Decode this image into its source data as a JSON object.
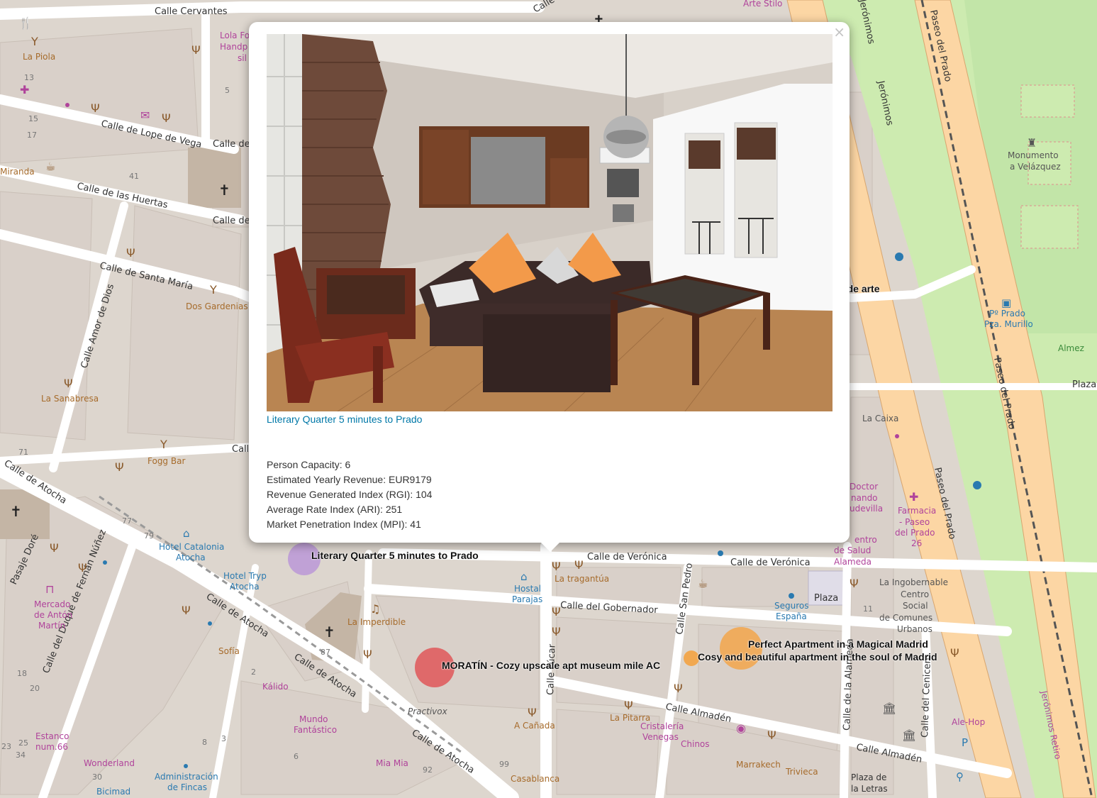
{
  "map": {
    "streets": [
      "Calle Cervantes",
      "Calle de Lope de Vega",
      "Calle de las Huertas",
      "Calle de Santa María",
      "Calle Amor de Dios",
      "Calle de Atocha",
      "Calle del Duque de Fernán Núñez",
      "Pasaje Doré",
      "Calle de Verónica",
      "Calle del Gobernador",
      "Calle San Pedro",
      "Calle Almadén",
      "Calle de la Alameda",
      "Calle del Cenicero",
      "Paseo del Prado",
      "Jerónimos",
      "Calle Fúcar",
      "Calle de",
      "Call",
      "Calle"
    ],
    "places": [
      "La Piola",
      "Lola Fo",
      "Handp",
      "sil",
      "Dos Gardenias",
      "La Sanabresa",
      "Fogg Bar",
      "Hotel Catalonia",
      "Atocha",
      "Hotel Tryp",
      "Mercado",
      "de Antón",
      "Martín",
      "Sofía",
      "Kálido",
      "Mundo",
      "Fantástico",
      "Wonderland",
      "Administración",
      "de Fincas",
      "Bicimad",
      "Estanco",
      "num.66",
      "La Imperdible",
      "Hostal",
      "Parajas",
      "La tragantúa",
      "Practivox",
      "A Cañada",
      "Mia Mia",
      "Casablanca",
      "La Pitarra",
      "Cristalería",
      "Venegas",
      "Chinos",
      "Marrakech",
      "Trivieca",
      "Seguros",
      "España",
      "Plaza",
      "La Ingobernable",
      "Centro",
      "Social",
      "de Comunes",
      "Urbanos",
      "Plaza de",
      "la Letras",
      "Ale-Hop",
      "La Caixa",
      "Farmacia",
      "- Paseo",
      "del Prado",
      "26",
      "Monumento",
      "a Velázquez",
      "Pº Prado",
      "Pza. Murillo",
      "Almez",
      "Arte Stilo",
      "Miranda",
      "Doctor",
      "nando",
      "udevilla",
      "entro",
      "de Salud",
      "Alameda",
      "Plaza",
      "Jerónimos Retiro"
    ],
    "numbers": [
      "13",
      "15",
      "17",
      "5",
      "41",
      "71",
      "77",
      "79",
      "87",
      "2",
      "18",
      "20",
      "23",
      "25",
      "34",
      "30",
      "3",
      "8",
      "6",
      "92",
      "99",
      "11"
    ]
  },
  "markers": [
    {
      "label": "Literary Quarter 5 minutes to Prado",
      "color": "#b58fd8"
    },
    {
      "label": "MORATÍN - Cozy upscale apt museum mile AC",
      "color": "#e0474a"
    },
    {
      "label": "Perfect Apartment in a Magical Madrid",
      "color": "#f5a03a"
    },
    {
      "label": "Cosy and beautiful apartment in the soul of Madrid",
      "color": "#f5a03a"
    },
    {
      "label": "Piso agradable rodeado de arte",
      "color": "#f5a03a"
    }
  ],
  "popup": {
    "close": "×",
    "link_text": "Literary Quarter 5 minutes to Prado",
    "stats": {
      "capacity": "Person Capacity: 6",
      "revenue": "Estimated Yearly Revenue: EUR9179",
      "rgi": "Revenue Generated Index (RGI): 104",
      "ari": "Average Rate Index (ARI): 251",
      "mpi": "Market Penetration Index (MPI): 41"
    }
  },
  "colors": {
    "map_bg": "#f2efe9",
    "building": "#d9d0c9",
    "park": "#cdebb0",
    "major_road": "#fcd6a4",
    "popup_link": "#0078a8"
  }
}
